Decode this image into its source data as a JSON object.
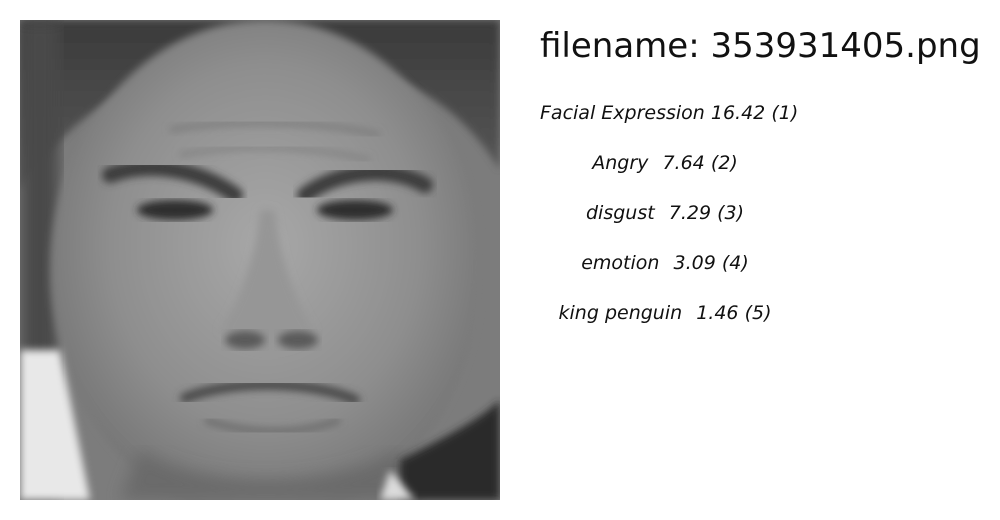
{
  "header": {
    "filename_prefix": "filename:",
    "filename_value": "353931405.png"
  },
  "image": {
    "icon": "grayscale-face-photo"
  },
  "predictions": [
    {
      "label": "Facial Expression",
      "score": "16.42",
      "rank": "(1)"
    },
    {
      "label": "Angry",
      "score": "7.64",
      "rank": "(2)"
    },
    {
      "label": "disgust",
      "score": "7.29",
      "rank": "(3)"
    },
    {
      "label": "emotion",
      "score": "3.09",
      "rank": "(4)"
    },
    {
      "label": "king penguin",
      "score": "1.46",
      "rank": "(5)"
    }
  ]
}
